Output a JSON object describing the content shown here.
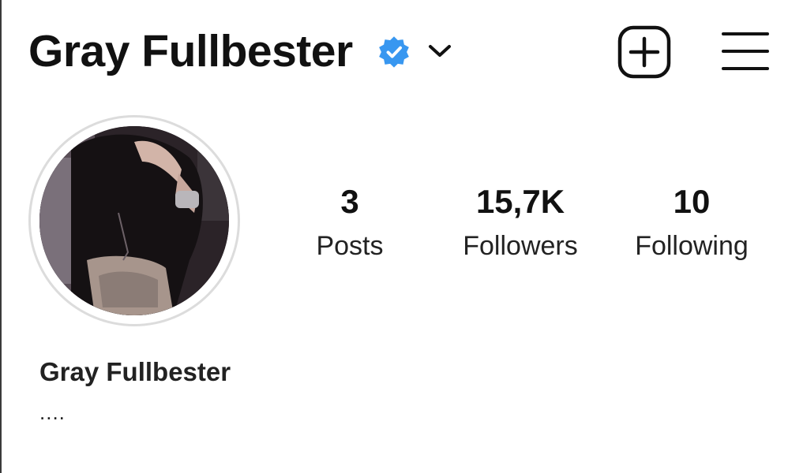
{
  "header": {
    "username": "Gray Fullbester",
    "icons": {
      "verified": "verified-badge-icon",
      "switch_account": "chevron-down-icon",
      "new_post": "plus-square-icon",
      "menu": "hamburger-menu-icon"
    },
    "colors": {
      "verified_badge": "#3897f0"
    }
  },
  "profile": {
    "avatar": "profile-avatar",
    "stats": {
      "posts": {
        "value": "3",
        "label": "Posts"
      },
      "followers": {
        "value": "15,7K",
        "label": "Followers"
      },
      "following": {
        "value": "10",
        "label": "Following"
      }
    },
    "display_name": "Gray Fullbester",
    "bio": "...."
  }
}
